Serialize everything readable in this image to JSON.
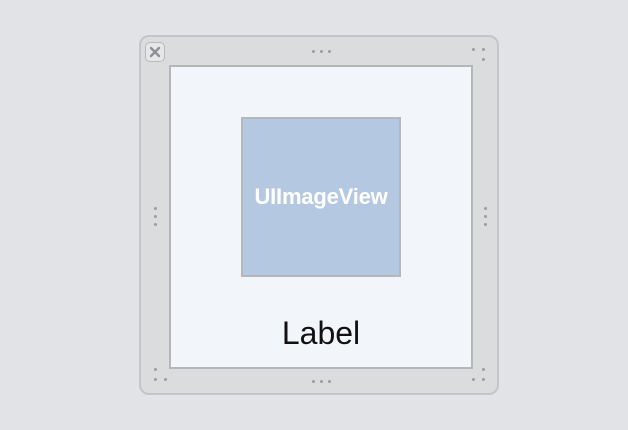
{
  "canvas": {
    "background": "#e2e3e6"
  },
  "container": {
    "close_icon": "close-icon",
    "handle_icon": "resize-handle-dots-icon"
  },
  "image_view": {
    "text": "UIImageView",
    "fill_color": "#b5c8e1"
  },
  "label": {
    "text": "Label"
  }
}
